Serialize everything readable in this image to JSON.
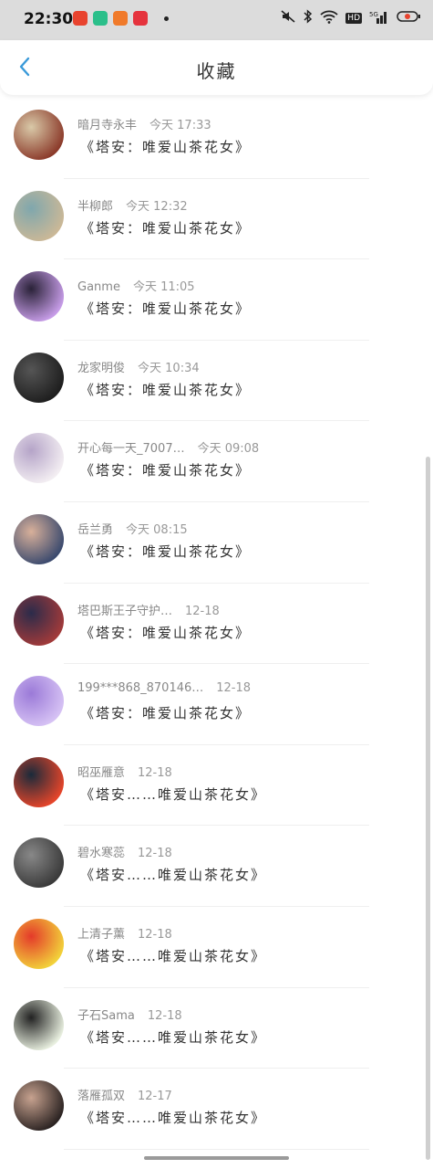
{
  "status": {
    "time": "22:30",
    "app_icons": [
      {
        "name": "news-app-icon",
        "color": "#e8432e"
      },
      {
        "name": "camera-app-icon",
        "color": "#2bbf8a"
      },
      {
        "name": "taobao-app-icon",
        "color": "#f07a2a"
      },
      {
        "name": "pinduoduo-app-icon",
        "color": "#e5333d"
      }
    ],
    "hd_label": "HD",
    "signal_label": "5G"
  },
  "header": {
    "back_icon": "chevron-left-icon",
    "title": "收藏"
  },
  "colors": {
    "accent": "#3a9ad9",
    "name": "#888888",
    "title": "#333333"
  },
  "items": [
    {
      "name": "暗月寺永丰",
      "time": "今天 17:33",
      "title": "《塔安：唯爱山茶花女》",
      "avatar": [
        "#8b3a2a",
        "#d9c9a8"
      ]
    },
    {
      "name": "半柳郎",
      "time": "今天 12:32",
      "title": "《塔安：唯爱山茶花女》",
      "avatar": [
        "#cbb897",
        "#7fa7ad"
      ]
    },
    {
      "name": "Ganme",
      "time": "今天 11:05",
      "title": "《塔安：唯爱山茶花女》",
      "avatar": [
        "#c79de8",
        "#2a2238"
      ]
    },
    {
      "name": "龙家明俊",
      "time": "今天 10:34",
      "title": "《塔安：唯爱山茶花女》",
      "avatar": [
        "#1e1e1e",
        "#555555"
      ]
    },
    {
      "name": "开心每一天_7007…",
      "time": "今天 09:08",
      "title": "《塔安：唯爱山茶花女》",
      "avatar": [
        "#f3eef2",
        "#b5a4c8"
      ]
    },
    {
      "name": "岳兰勇",
      "time": "今天 08:15",
      "title": "《塔安：唯爱山茶花女》",
      "avatar": [
        "#3b4a6e",
        "#d8b09a"
      ]
    },
    {
      "name": "塔巴斯王子守护…",
      "time": "12-18",
      "title": "《塔安：唯爱山茶花女》",
      "avatar": [
        "#a23a3a",
        "#2b2b4a"
      ]
    },
    {
      "name": "199***868_870146…",
      "time": "12-18",
      "title": "《塔安：唯爱山茶花女》",
      "avatar": [
        "#d6c2f4",
        "#9b7ad8"
      ]
    },
    {
      "name": "昭巫雁意",
      "time": "12-18",
      "title": "《塔安……唯爱山茶花女》",
      "avatar": [
        "#e6452a",
        "#1a2a3a"
      ]
    },
    {
      "name": "碧水寒蕊",
      "time": "12-18",
      "title": "《塔安……唯爱山茶花女》",
      "avatar": [
        "#3a3a3a",
        "#888888"
      ]
    },
    {
      "name": "上清子薰",
      "time": "12-18",
      "title": "《塔安……唯爱山茶花女》",
      "avatar": [
        "#f2d23a",
        "#e43a2a"
      ]
    },
    {
      "name": "子石Sama",
      "time": "12-18",
      "title": "《塔安……唯爱山茶花女》",
      "avatar": [
        "#e8efdf",
        "#222222"
      ]
    },
    {
      "name": "落雁孤双",
      "time": "12-17",
      "title": "《塔安……唯爱山茶花女》",
      "avatar": [
        "#2b2322",
        "#c7a28f"
      ]
    }
  ]
}
